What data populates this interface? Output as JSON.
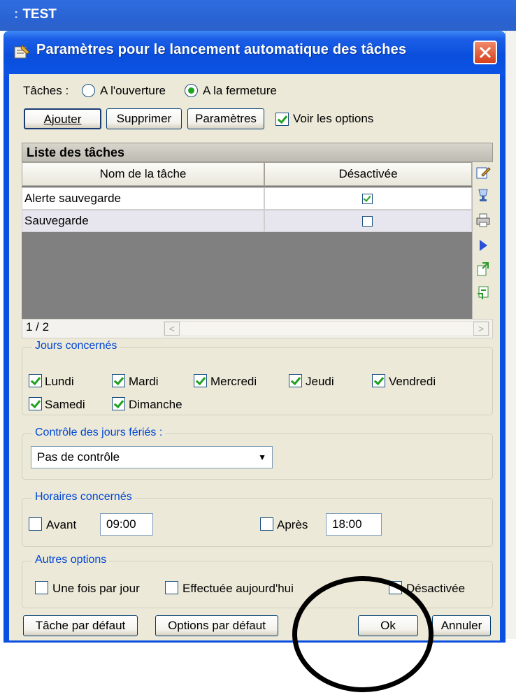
{
  "background_app": {
    "title": "TEST"
  },
  "dialog": {
    "title": "Paramètres pour le lancement automatique des tâches",
    "close_symbol": "✕",
    "icon": "tasks-settings-icon"
  },
  "taches": {
    "label": "Tâches :",
    "options": [
      {
        "label": "A l'ouverture",
        "selected": false
      },
      {
        "label": "A la fermeture",
        "selected": true
      }
    ]
  },
  "toolbar": {
    "ajouter": "Ajouter",
    "supprimer": "Supprimer",
    "parametres": "Paramètres",
    "voir_options": {
      "label": "Voir les options",
      "checked": true
    }
  },
  "task_list": {
    "title": "Liste des tâches",
    "columns": [
      "Nom de la tâche",
      "Désactivée"
    ],
    "rows": [
      {
        "name": "Alerte sauvegarde",
        "disabled": true
      },
      {
        "name": "Sauvegarde",
        "disabled": false
      }
    ],
    "counter": "1 / 2",
    "side_icons": [
      "edit-icon",
      "goblet-icon",
      "print-icon",
      "play-arrow-icon",
      "export-icon",
      "import-icon"
    ]
  },
  "jours": {
    "title": "Jours concernés",
    "days": [
      {
        "label": "Lundi",
        "checked": true
      },
      {
        "label": "Mardi",
        "checked": true
      },
      {
        "label": "Mercredi",
        "checked": true
      },
      {
        "label": "Jeudi",
        "checked": true
      },
      {
        "label": "Vendredi",
        "checked": true
      },
      {
        "label": "Samedi",
        "checked": true
      },
      {
        "label": "Dimanche",
        "checked": true
      }
    ]
  },
  "feries": {
    "title": "Contrôle des jours fériés :",
    "selected": "Pas de contrôle"
  },
  "horaires": {
    "title": "Horaires concernés",
    "avant": {
      "label": "Avant",
      "checked": false,
      "value": "09:00"
    },
    "apres": {
      "label": "Après",
      "checked": false,
      "value": "18:00"
    }
  },
  "autres": {
    "title": "Autres options",
    "une_fois": {
      "label": "Une fois par jour",
      "checked": false
    },
    "effectuee": {
      "label": "Effectuée aujourd'hui",
      "checked": false
    },
    "desactivee": {
      "label": "Désactivée",
      "checked": false
    }
  },
  "footer": {
    "tache_defaut": "Tâche par défaut",
    "options_defaut": "Options par défaut",
    "ok": "Ok",
    "annuler": "Annuler"
  }
}
